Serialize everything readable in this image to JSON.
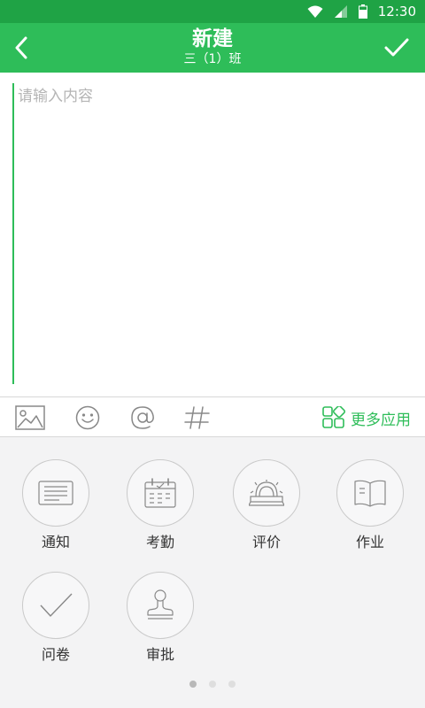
{
  "status_bar": {
    "time": "12:30"
  },
  "header": {
    "title": "新建",
    "subtitle": "三（1）班"
  },
  "editor": {
    "placeholder": "请输入内容",
    "value": ""
  },
  "toolbar": {
    "more_label": "更多应用"
  },
  "apps": [
    {
      "label": "通知",
      "icon": "notice-icon"
    },
    {
      "label": "考勤",
      "icon": "calendar-icon"
    },
    {
      "label": "评价",
      "icon": "award-icon"
    },
    {
      "label": "作业",
      "icon": "book-icon"
    },
    {
      "label": "问卷",
      "icon": "check-icon"
    },
    {
      "label": "审批",
      "icon": "stamp-icon"
    }
  ],
  "pager": {
    "pages": 3,
    "active": 1
  },
  "colors": {
    "status_bar": "#1fa345",
    "app_bar": "#2ebd59",
    "accent": "#2ebd59",
    "panel": "#f3f3f4"
  }
}
